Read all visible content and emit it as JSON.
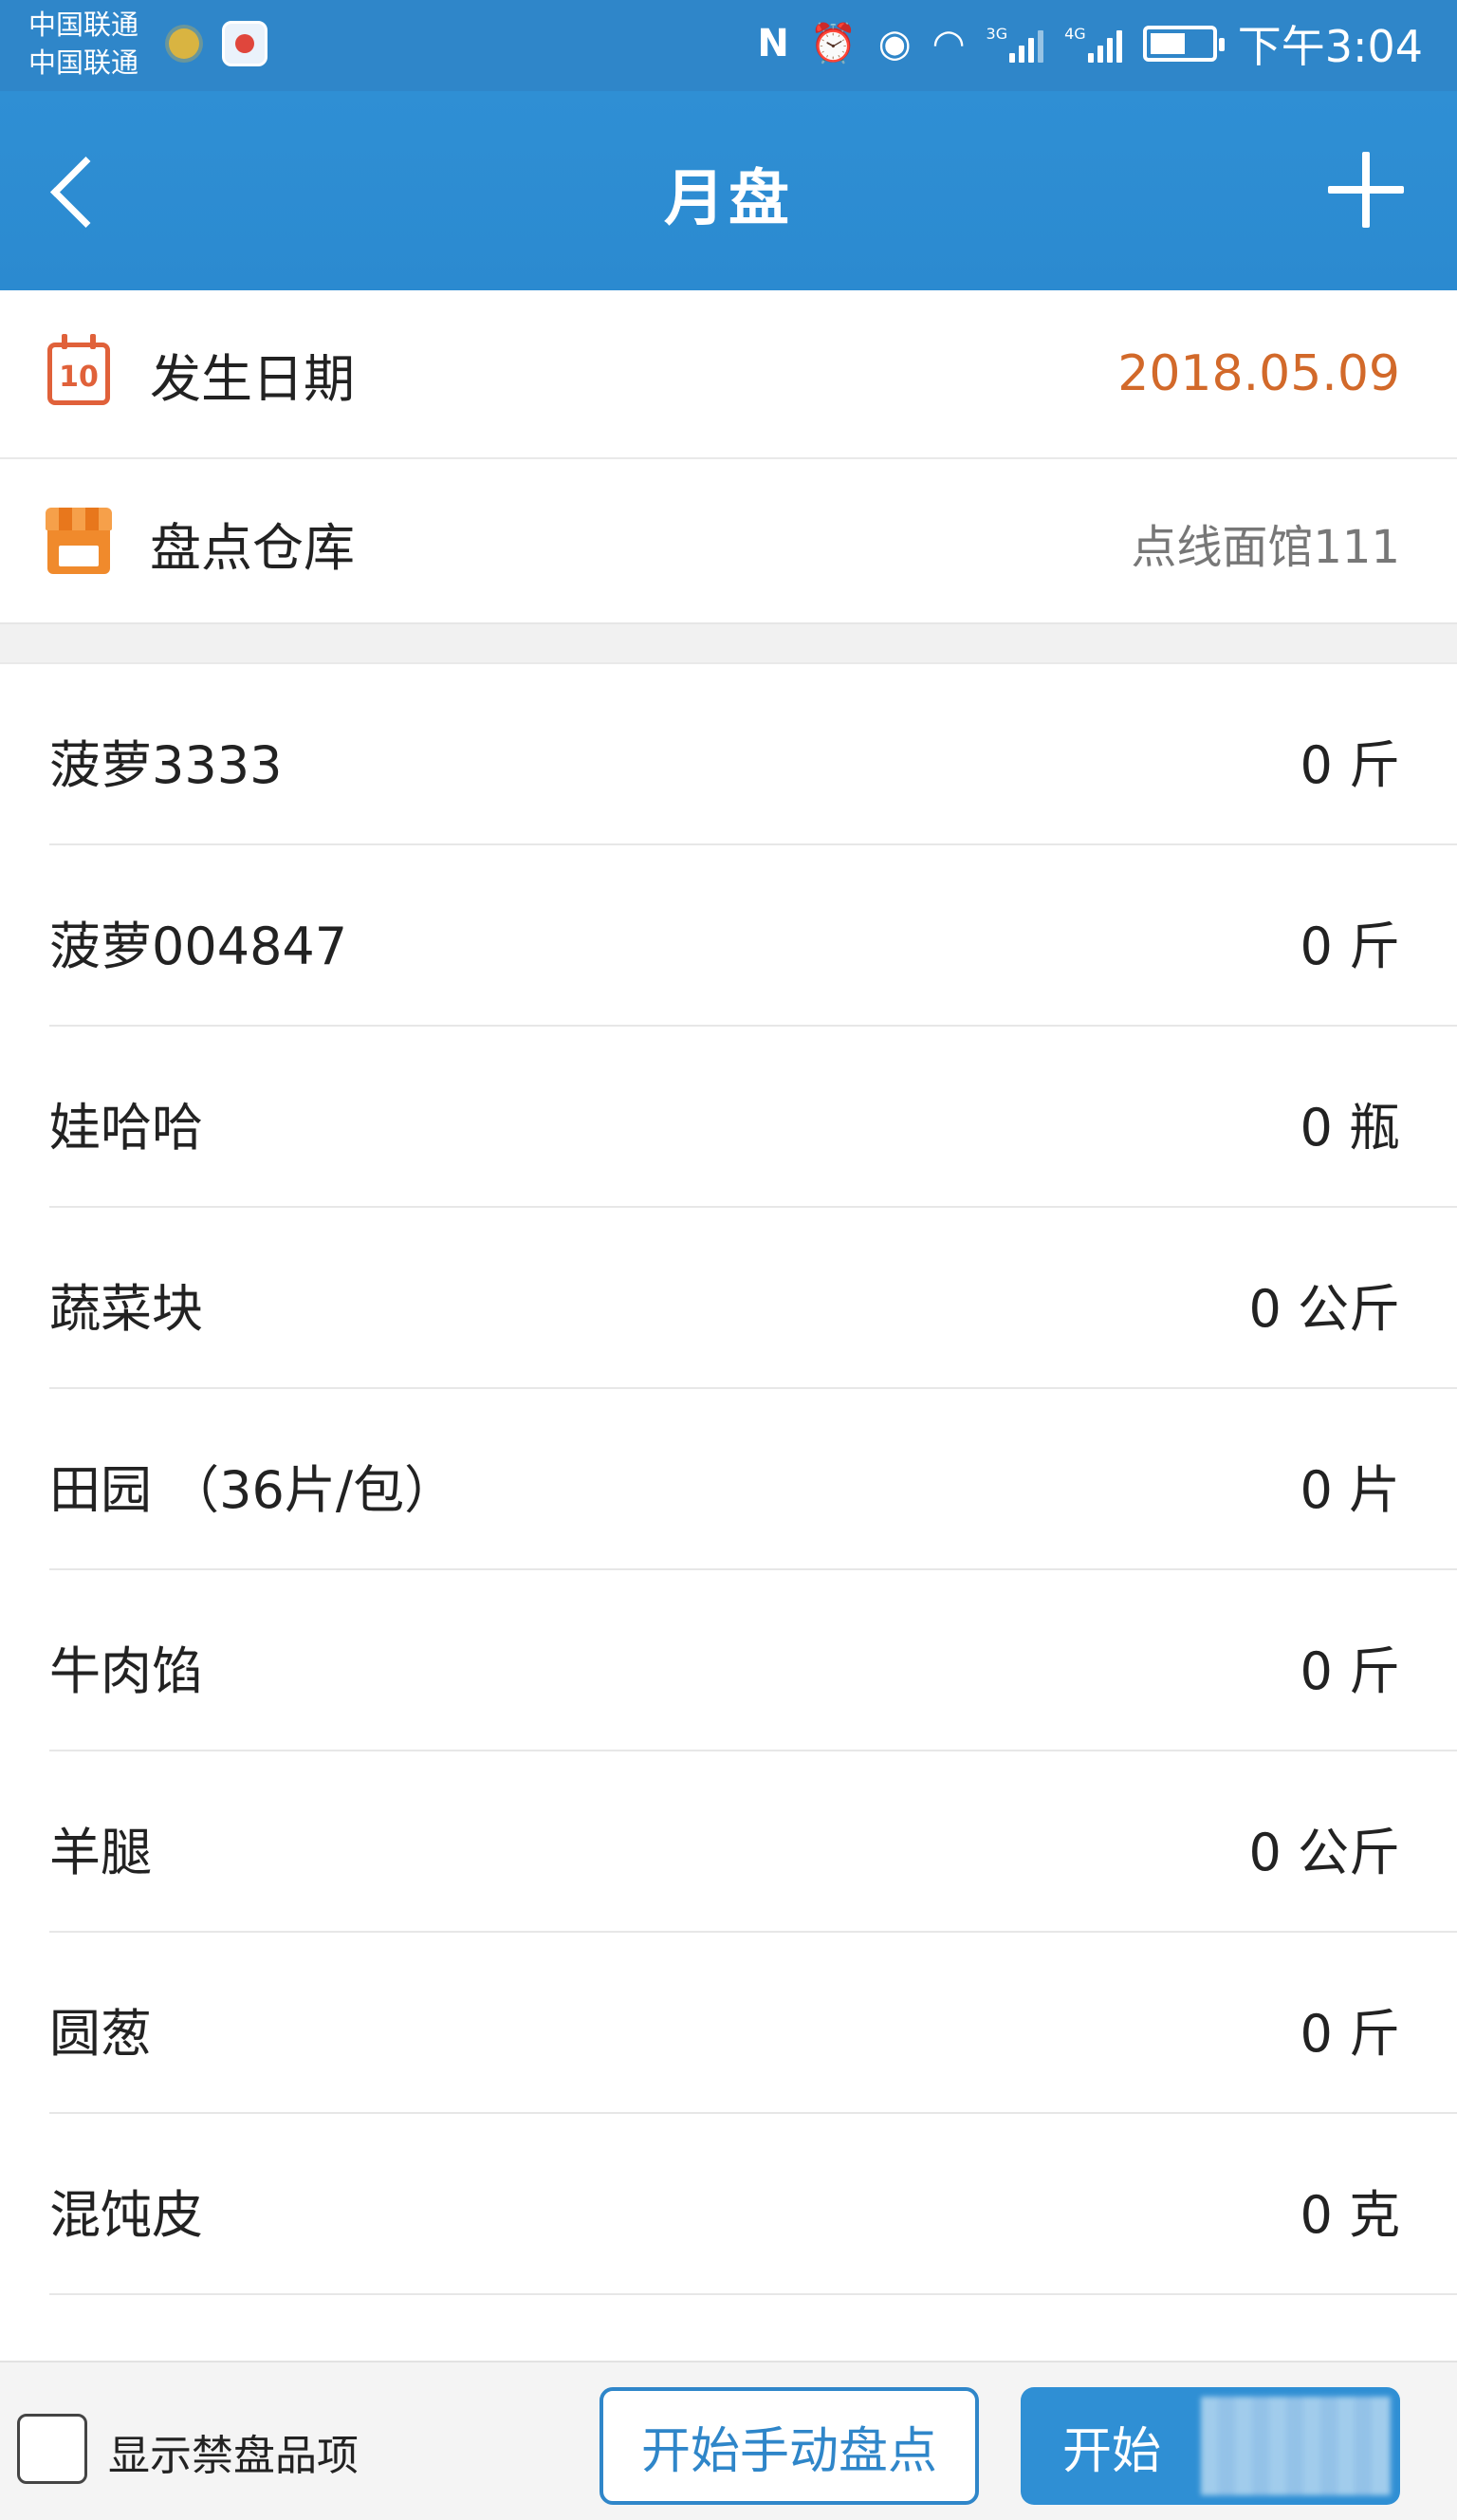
{
  "status_bar": {
    "carrier_1": "中国联通",
    "carrier_2": "中国联通",
    "time": "下午3:04",
    "icons": [
      "weather-icon",
      "app-notification-icon",
      "nfc-icon",
      "alarm-icon",
      "eye-comfort-icon",
      "wifi-icon",
      "signal-3g-icon",
      "signal-4g-icon",
      "battery-icon"
    ],
    "nfc_glyph": "N",
    "alarm_glyph": "⏰",
    "eye_glyph": "◉",
    "wifi_glyph": "◠",
    "net_1": "3G",
    "net_2": "4G"
  },
  "navbar": {
    "title": "月盘",
    "back_icon": "chevron-left-icon",
    "add_icon": "plus-icon"
  },
  "info": {
    "date_label": "发生日期",
    "date_value": "2018.05.09",
    "date_icon_text": "10",
    "warehouse_label": "盘点仓库",
    "warehouse_value": "点线面馆111"
  },
  "items": [
    {
      "name": "菠萝3333",
      "qty": "0 斤"
    },
    {
      "name": "菠萝004847",
      "qty": "0 斤"
    },
    {
      "name": "娃哈哈",
      "qty": "0 瓶"
    },
    {
      "name": "蔬菜块",
      "qty": "0 公斤"
    },
    {
      "name": "田园 （36片/包）",
      "qty": "0 片"
    },
    {
      "name": "牛肉馅",
      "qty": "0 斤"
    },
    {
      "name": "羊腿",
      "qty": "0 公斤"
    },
    {
      "name": "圆葱",
      "qty": "0 斤"
    },
    {
      "name": "混饨皮",
      "qty": "0 克"
    }
  ],
  "bottom": {
    "checkbox_label": "显示禁盘品项",
    "checkbox_checked": false,
    "manual_button": "开始手动盘点",
    "scan_button_visible": "开始"
  },
  "colors": {
    "primary": "#2f86c9",
    "date_value": "#d2692a",
    "warehouse_value": "#777777",
    "calendar_icon": "#e0613a",
    "store_icon": "#f08a2c"
  }
}
